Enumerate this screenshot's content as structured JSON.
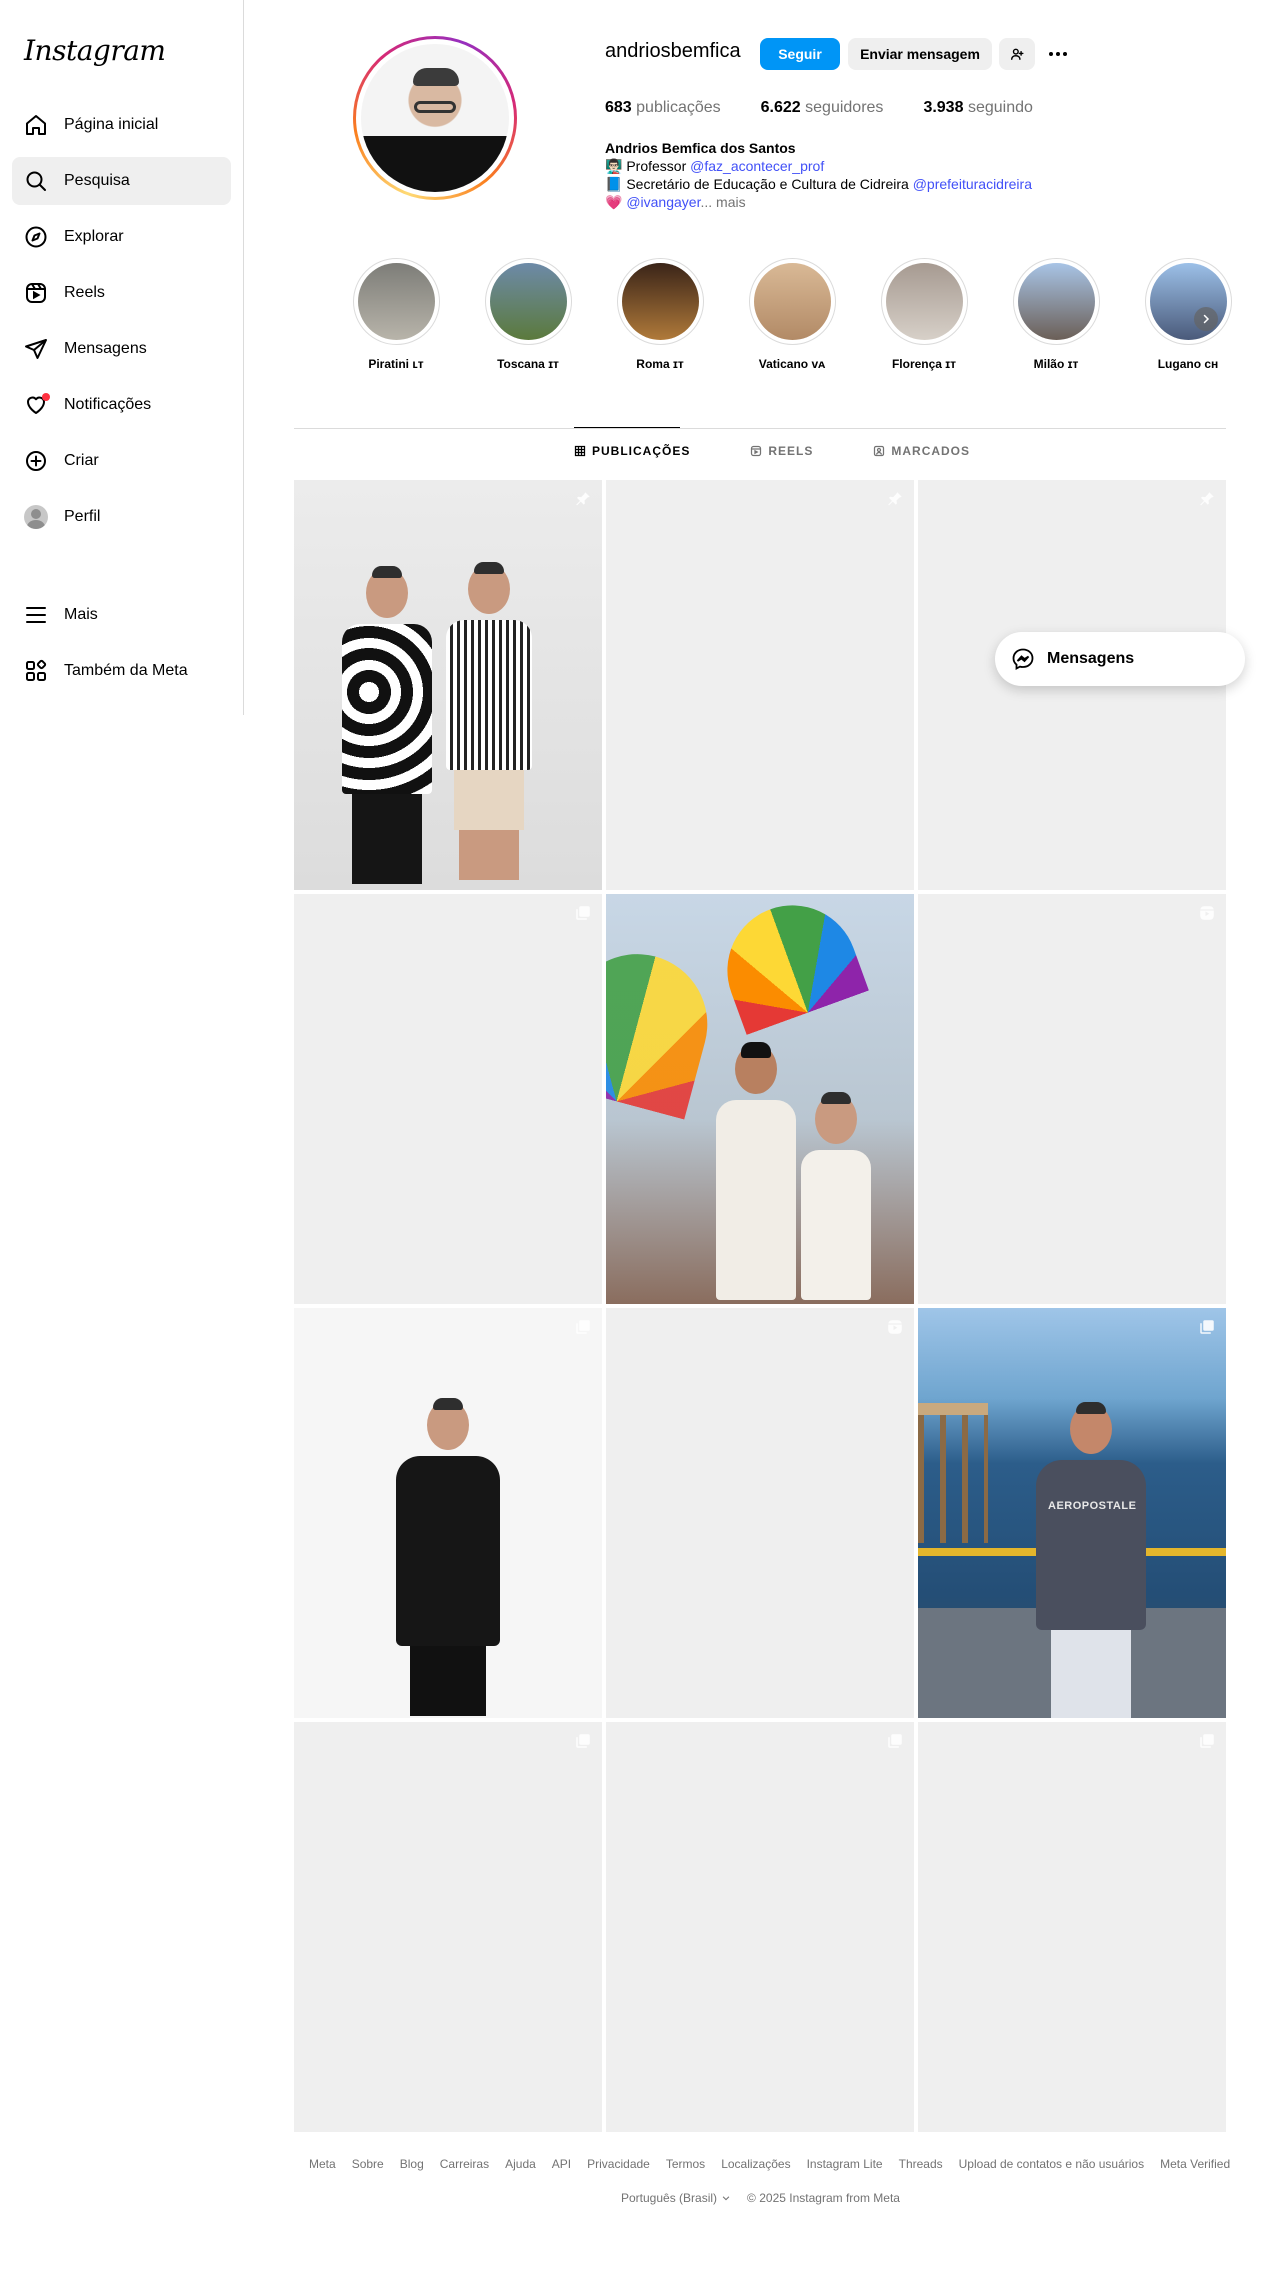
{
  "sidebar": {
    "logo": "Instagram",
    "items": [
      {
        "label": "Página inicial",
        "icon": "home-icon"
      },
      {
        "label": "Pesquisa",
        "icon": "search-icon"
      },
      {
        "label": "Explorar",
        "icon": "compass-icon"
      },
      {
        "label": "Reels",
        "icon": "reels-icon"
      },
      {
        "label": "Mensagens",
        "icon": "send-icon"
      },
      {
        "label": "Notificações",
        "icon": "heart-icon"
      },
      {
        "label": "Criar",
        "icon": "plus-square-icon"
      },
      {
        "label": "Perfil",
        "icon": "avatar"
      }
    ],
    "more": "Mais",
    "also_meta": "Também da Meta"
  },
  "profile": {
    "username": "andriosbemfica",
    "follow_label": "Seguir",
    "message_label": "Enviar mensagem",
    "stats": {
      "posts_count": "683",
      "posts_label": "publicações",
      "followers_count": "6.622",
      "followers_label": "seguidores",
      "following_count": "3.938",
      "following_label": "seguindo"
    },
    "bio": {
      "name": "Andrios Bemfica dos Santos",
      "line1_emoji": "👨🏻‍🏫",
      "line1_text": "Professor",
      "line1_link": "@faz_acontecer_prof",
      "line2_emoji": "📘",
      "line2_text": "Secretário de Educação e Cultura de Cidreira",
      "line2_link": "@prefeituracidreira",
      "line3_emoji": "💗",
      "line3_link": "@ivangayer",
      "line3_more": "... mais"
    }
  },
  "highlights": [
    {
      "label": "Piratini 🇱🇹",
      "label_text": "Piratini ʟᴛ",
      "color1": "#7d7d78",
      "color2": "#b8b4aa"
    },
    {
      "label_text": "Toscana ɪᴛ",
      "color1": "#6d8aa8",
      "color2": "#5b7a3c"
    },
    {
      "label_text": "Roma ɪᴛ",
      "color1": "#3a2418",
      "color2": "#b07a3a"
    },
    {
      "label_text": "Vaticano ᴠᴀ",
      "color1": "#d9b996",
      "color2": "#b28a66"
    },
    {
      "label_text": "Florença ɪᴛ",
      "color1": "#a69a91",
      "color2": "#d7d0c8"
    },
    {
      "label_text": "Milão ɪᴛ",
      "color1": "#a8c4e6",
      "color2": "#6b5f57"
    },
    {
      "label_text": "Lugano ᴄʜ",
      "color1": "#9cc0e8",
      "color2": "#4a5a7a"
    }
  ],
  "tabs": [
    {
      "label": "PUBLICAÇÕES",
      "icon": "grid-icon",
      "active": true
    },
    {
      "label": "REELS",
      "icon": "reels-icon",
      "active": false
    },
    {
      "label": "MARCADOS",
      "icon": "tag-icon",
      "active": false
    }
  ],
  "posts": [
    {
      "badge": "pin-icon"
    },
    {
      "badge": "pin-icon"
    },
    {
      "badge": "pin-icon"
    },
    {
      "badge": "carousel-icon"
    },
    {
      "badge": "none"
    },
    {
      "badge": "reel-icon"
    },
    {
      "badge": "carousel-icon"
    },
    {
      "badge": "reel-icon"
    },
    {
      "badge": "carousel-icon"
    },
    {
      "badge": "carousel-icon"
    },
    {
      "badge": "carousel-icon"
    },
    {
      "badge": "carousel-icon"
    }
  ],
  "pier_photo_text": "AEROPOSTALE",
  "floating_messages": "Mensagens",
  "footer": {
    "links": [
      "Meta",
      "Sobre",
      "Blog",
      "Carreiras",
      "Ajuda",
      "API",
      "Privacidade",
      "Termos",
      "Localizações",
      "Instagram Lite",
      "Threads",
      "Upload de contatos e não usuários",
      "Meta Verified"
    ],
    "language": "Português (Brasil)",
    "copyright": "© 2025 Instagram from Meta"
  },
  "colors": {
    "accent": "#0095f6",
    "link": "#4150f7",
    "notification": "#ff3040"
  }
}
